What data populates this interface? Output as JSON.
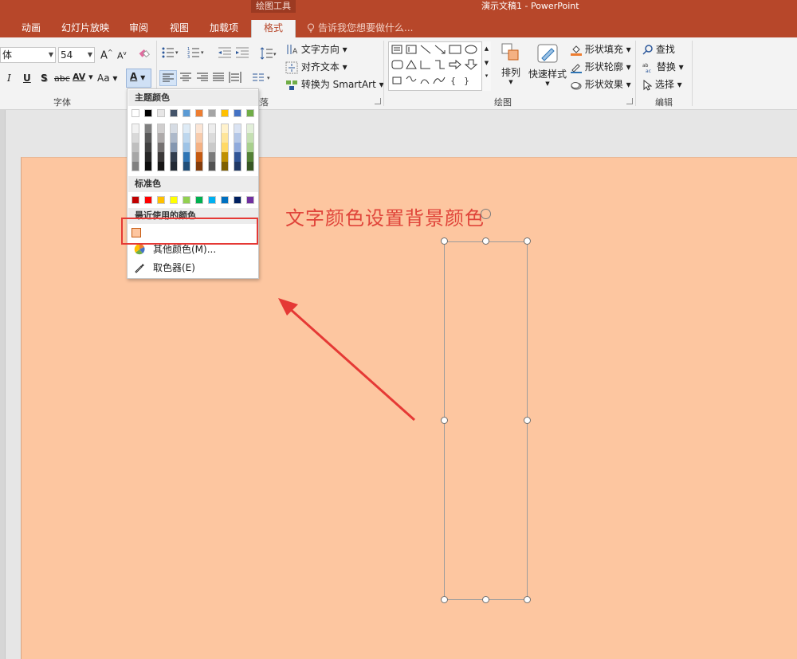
{
  "window": {
    "context_tab_label": "绘图工具",
    "title": "演示文稿1 - PowerPoint"
  },
  "tabs": [
    {
      "label": "动画"
    },
    {
      "label": "幻灯片放映"
    },
    {
      "label": "审阅"
    },
    {
      "label": "视图"
    },
    {
      "label": "加载项"
    },
    {
      "label": "格式"
    }
  ],
  "tell_me": "告诉我您想要做什么...",
  "ribbon": {
    "font": {
      "font_name": "体",
      "font_size": "54",
      "grow": "A",
      "shrink": "A",
      "italic": "I",
      "underline": "U",
      "shadow": "S",
      "strike": "abc",
      "spacing": "AV",
      "case": "Aa",
      "font_color": "A",
      "group_label": "字体"
    },
    "paragraph": {
      "text_direction": "文字方向",
      "align_text": "对齐文本",
      "convert_smartart": "转换为 SmartArt",
      "group_label": "段落"
    },
    "drawing": {
      "arrange": "排列",
      "quick_styles": "快速样式",
      "shape_fill": "形状填充",
      "shape_outline": "形状轮廓",
      "shape_effects": "形状效果",
      "group_label": "绘图"
    },
    "editing": {
      "find": "查找",
      "replace": "替换",
      "select": "选择",
      "group_label": "编辑"
    }
  },
  "color_menu": {
    "theme_heading": "主题颜色",
    "theme_top": [
      "#ffffff",
      "#000000",
      "#e7e6e6",
      "#44546a",
      "#5b9bd5",
      "#ed7d31",
      "#a5a5a5",
      "#ffc000",
      "#4472c4",
      "#70ad47"
    ],
    "theme_shades": [
      [
        "#f2f2f2",
        "#d9d9d9",
        "#bfbfbf",
        "#a6a6a6",
        "#808080"
      ],
      [
        "#808080",
        "#595959",
        "#404040",
        "#262626",
        "#0d0d0d"
      ],
      [
        "#d0cece",
        "#aeaaaa",
        "#757171",
        "#3b3838",
        "#171616"
      ],
      [
        "#d6dce4",
        "#adb9ca",
        "#8497b0",
        "#333f4f",
        "#222a35"
      ],
      [
        "#deebf6",
        "#bdd7ee",
        "#9dc3e6",
        "#2e75b5",
        "#1f4e79"
      ],
      [
        "#fbe5d5",
        "#f7cbac",
        "#f4b183",
        "#c55a11",
        "#833c0b"
      ],
      [
        "#ededed",
        "#dbdbdb",
        "#c9c9c9",
        "#7b7b7b",
        "#525252"
      ],
      [
        "#fff2cc",
        "#fee599",
        "#ffd965",
        "#bf9000",
        "#7f6000"
      ],
      [
        "#dae3f3",
        "#b4c7e7",
        "#8faadc",
        "#2f5496",
        "#203864"
      ],
      [
        "#e2efd9",
        "#c5e0b3",
        "#a8d08d",
        "#538135",
        "#375623"
      ]
    ],
    "standard_heading": "标准色",
    "standard": [
      "#c00000",
      "#ff0000",
      "#ffc000",
      "#ffff00",
      "#92d050",
      "#00b050",
      "#00b0f0",
      "#0070c0",
      "#002060",
      "#7030a0"
    ],
    "recent_heading": "最近使用的颜色",
    "recent": [
      "#fdc6a0"
    ],
    "more_colors": "其他颜色(M)...",
    "eyedropper": "取色器(E)"
  },
  "slide": {
    "background": "#fdc6a0",
    "text": "文字颜色设置背景颜色"
  },
  "colors": {
    "accent": "#b7472a",
    "annotation": "#e53935"
  }
}
